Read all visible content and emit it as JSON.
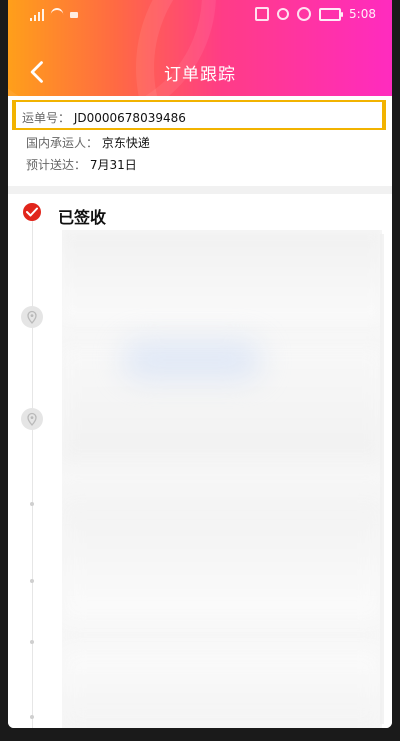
{
  "status_bar": {
    "time": "5:08"
  },
  "header": {
    "title": "订单跟踪",
    "back_icon": "back-arrow-icon"
  },
  "shipment": {
    "tracking_label": "运单号：",
    "tracking_number": "JD0000678039486",
    "carrier_label": "国内承运人：",
    "carrier_value": "京东快递",
    "eta_label": "预计送达：",
    "eta_value": "7月31日"
  },
  "timeline": {
    "signed_label": "已签收",
    "icons": [
      "check-icon",
      "pin-icon",
      "pin-icon"
    ]
  },
  "colors": {
    "accent_red": "#e1251b",
    "highlight_yellow": "#f2b300"
  }
}
